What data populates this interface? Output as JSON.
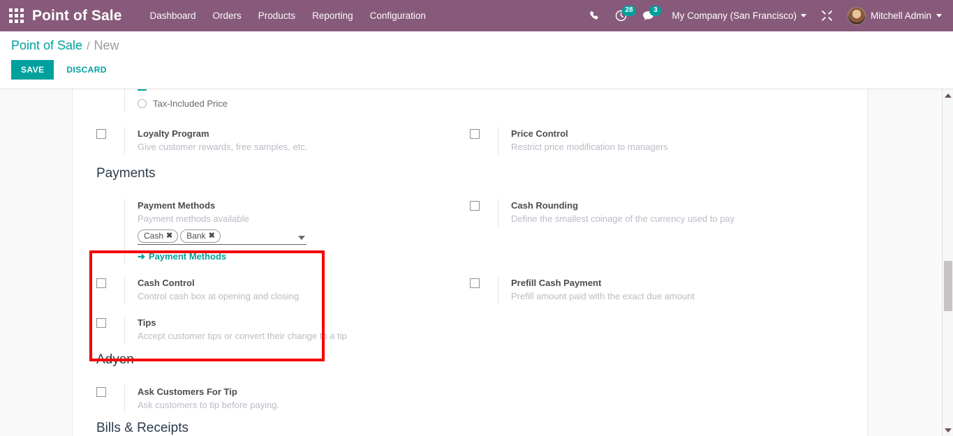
{
  "navbar": {
    "apps_icon": "apps-grid-icon",
    "brand": "Point of Sale",
    "menu": [
      {
        "label": "Dashboard"
      },
      {
        "label": "Orders"
      },
      {
        "label": "Products"
      },
      {
        "label": "Reporting"
      },
      {
        "label": "Configuration"
      }
    ],
    "icons": {
      "phone": "phone-icon",
      "activity": "clock-activity-icon",
      "activity_count": "28",
      "messages": "chat-bubble-icon",
      "messages_count": "3",
      "debug": "bug-tools-icon"
    },
    "company": "My Company (San Francisco)",
    "user": "Mitchell Admin"
  },
  "control_panel": {
    "breadcrumb_root": "Point of Sale",
    "breadcrumb_sep": "/",
    "breadcrumb_current": "New",
    "save_label": "SAVE",
    "discard_label": "DISCARD"
  },
  "settings": {
    "tax_included": {
      "label": "Tax-Included Price",
      "checked": false
    },
    "loyalty_program": {
      "label": "Loyalty Program",
      "help": "Give customer rewards, free samples, etc."
    },
    "price_control": {
      "label": "Price Control",
      "help": "Restrict price modification to managers"
    },
    "payments_section": {
      "title": "Payments",
      "payment_methods": {
        "label": "Payment Methods",
        "help": "Payment methods available",
        "tags": [
          {
            "name": "Cash",
            "remove": "✖"
          },
          {
            "name": "Bank",
            "remove": "✖"
          }
        ],
        "dropdown_icon": "chevron-down-icon",
        "link_arrow": "➔",
        "link_label": "Payment Methods"
      }
    },
    "cash_rounding": {
      "label": "Cash Rounding",
      "help": "Define the smallest coinage of the currency used to pay"
    },
    "cash_control": {
      "label": "Cash Control",
      "help": "Control cash box at opening and closing"
    },
    "prefill_cash_payment": {
      "label": "Prefill Cash Payment",
      "help": "Prefill amount paid with the exact due amount"
    },
    "tips": {
      "label": "Tips",
      "help": "Accept customer tips or convert their change to a tip"
    },
    "adyen_section": {
      "title": "Adyen",
      "ask_customers_for_tip": {
        "label": "Ask Customers For Tip",
        "help": "Ask customers to tip before paying."
      }
    },
    "bills_receipts_section": {
      "title": "Bills & Receipts"
    }
  },
  "scrollbar": {
    "up_icon": "scroll-up-arrow-icon",
    "down_icon": "scroll-down-arrow-icon"
  },
  "colors": {
    "navbar": "#875a7b",
    "accent": "#00a09d",
    "highlight": "#f50000"
  }
}
